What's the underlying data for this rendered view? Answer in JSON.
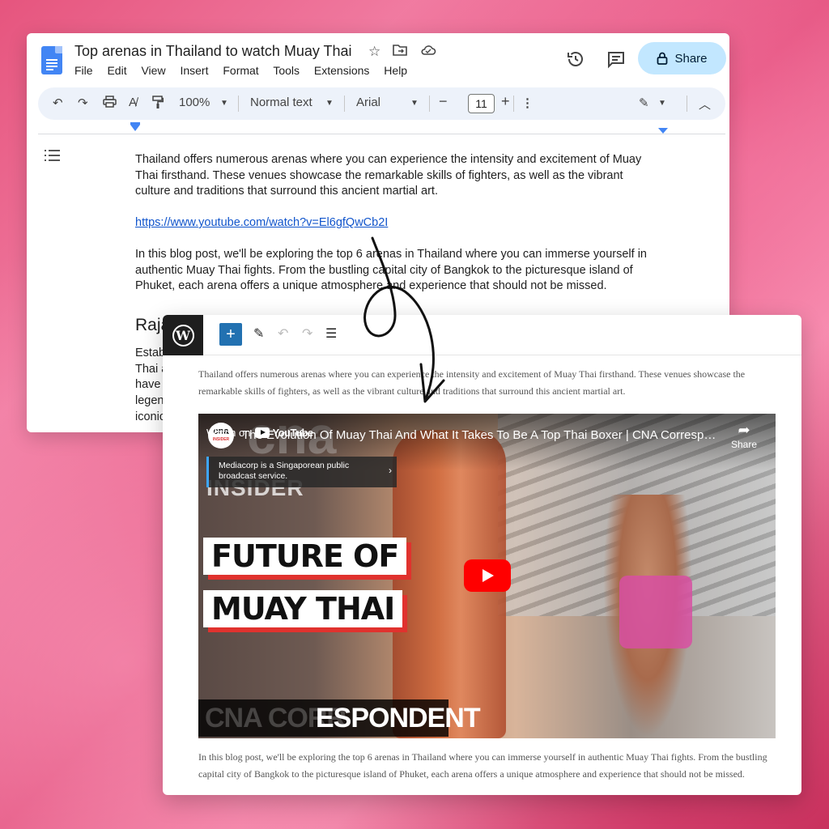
{
  "docs": {
    "title": "Top arenas in Thailand to watch Muay Thai",
    "menu": [
      "File",
      "Edit",
      "View",
      "Insert",
      "Format",
      "Tools",
      "Extensions",
      "Help"
    ],
    "share_label": "Share",
    "toolbar": {
      "zoom": "100%",
      "style": "Normal text",
      "font": "Arial",
      "font_size": "11"
    },
    "body": {
      "p1": "Thailand offers numerous arenas where you can experience the intensity and excitement of Muay Thai firsthand. These venues showcase the remarkable skills of fighters, as well as the vibrant culture and traditions that surround this ancient martial art.",
      "link": "https://www.youtube.com/watch?v=El6gfQwCb2I",
      "p2": "In this blog post, we'll be exploring the top 6 arenas in Thailand where you can immerse yourself in authentic Muay Thai fights. From the bustling capital city of Bangkok to the picturesque island of Phuket, each arena offers a unique atmosphere and experience that should not be missed.",
      "heading_cut": "Raja",
      "cut_lines": [
        "Estab",
        "Thai a",
        "have",
        "legen",
        "iconic"
      ]
    }
  },
  "wordpress": {
    "p1": "Thailand offers numerous arenas where you can experience the intensity and excitement of Muay Thai firsthand. These venues showcase the remarkable skills of fighters, as well as the vibrant culture and traditions that surround this ancient martial art.",
    "p2": "In this blog post, we'll be exploring the top 6 arenas in Thailand where you can immerse yourself in authentic Muay Thai fights. From the bustling capital city of Bangkok to the picturesque island of Phuket, each arena offers a unique atmosphere and experience that should not be missed.",
    "video": {
      "channel_line1": "cna",
      "channel_line2": "INSIDER",
      "title": "The Evolution Of Muay Thai And What It Takes To Be A Top Thai Boxer | CNA Correspondent",
      "share": "Share",
      "info": "Mediacorp is a Singaporean public broadcast service.",
      "overlay_cna": "cna",
      "overlay_insider": "INSIDER",
      "headline1": "FUTURE OF",
      "headline2": "MUAY THAI",
      "watch_on": "Watch on",
      "youtube": "YouTube",
      "bottom_ghost": "CNA CORR",
      "bottom_text": "ESPONDENT"
    }
  },
  "colors": {
    "share_bg": "#c2e7ff",
    "link": "#1155cc",
    "wp_accent": "#2271b1",
    "youtube_red": "#ff0000"
  }
}
